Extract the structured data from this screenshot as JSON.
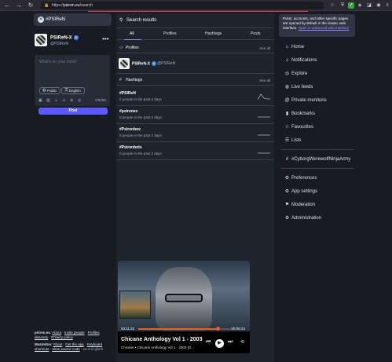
{
  "browser": {
    "url_host": "psiren.eu",
    "url_prefix": "https://",
    "url_path": "/search"
  },
  "left": {
    "search_query": "#PSIReN",
    "profile": {
      "name": "PSIReN-X",
      "handle": "@PSIReN"
    },
    "composer_placeholder": "What's on your mind?",
    "visibility_label": "Public",
    "language_label": "English",
    "char_count": "2/5000",
    "post_label": "Post",
    "footer": {
      "site": "psiren.eu",
      "about": "About",
      "invite": "Invite people",
      "profiles_dir": "Profiles directory",
      "privacy": "Privacy policy",
      "mastodon": "Mastodon",
      "about2": "About",
      "get_app": "Get the app",
      "keyboard": "Keyboard shortcuts",
      "source": "View source code",
      "version": "v4.3.8+glitch"
    }
  },
  "middle": {
    "header": "Search results",
    "tabs": [
      "All",
      "Profiles",
      "Hashtags",
      "Posts"
    ],
    "profiles_section": {
      "title": "Profiles",
      "see_all": "See all"
    },
    "profile_result": {
      "name": "PSIReN-X",
      "handle": "@PSIReN"
    },
    "hashtags_section": {
      "title": "Hashtags",
      "see_all": "See all"
    },
    "hashtags": [
      {
        "tag": "#PSIReN",
        "stats": "2 people in the past 2 days"
      },
      {
        "tag": "#psirenex",
        "stats": "0 people in the past 2 days"
      },
      {
        "tag": "#Psirenbox",
        "stats": "0 people in the past 2 days"
      },
      {
        "tag": "#Psirenbots",
        "stats": "0 people in the past 2 days"
      }
    ],
    "player": {
      "elapsed": "03:11:22",
      "duration": "00:06:24",
      "progress": 0.86,
      "title": "Chicane Anthology Vol 1 - 2003",
      "subtitle": "Chicane • Chicane Anthology Vol 1 - 2003 (D..."
    }
  },
  "right": {
    "notice": "Posts, accounts, and other specific pages are opened by default in the classic web interface.",
    "notice_link": "Open in advanced web interface",
    "nav": [
      {
        "label": "Home",
        "icon": "home-icon"
      },
      {
        "label": "Notifications",
        "icon": "bell-icon"
      },
      {
        "label": "Explore",
        "icon": "compass-icon"
      },
      {
        "label": "Live feeds",
        "icon": "live-feed-icon"
      },
      {
        "label": "Private mentions",
        "icon": "at-icon"
      },
      {
        "label": "Bookmarks",
        "icon": "bookmark-icon"
      },
      {
        "label": "Favourites",
        "icon": "star-icon"
      },
      {
        "label": "Lists",
        "icon": "list-icon"
      }
    ],
    "followed_tag": "#CyborgWerewolfNinjaArmy",
    "settings_nav": [
      {
        "label": "Preferences",
        "icon": "gear-icon"
      },
      {
        "label": "App settings",
        "icon": "gears-icon"
      },
      {
        "label": "Moderation",
        "icon": "moderation-icon"
      },
      {
        "label": "Administration",
        "icon": "admin-icon"
      }
    ]
  }
}
